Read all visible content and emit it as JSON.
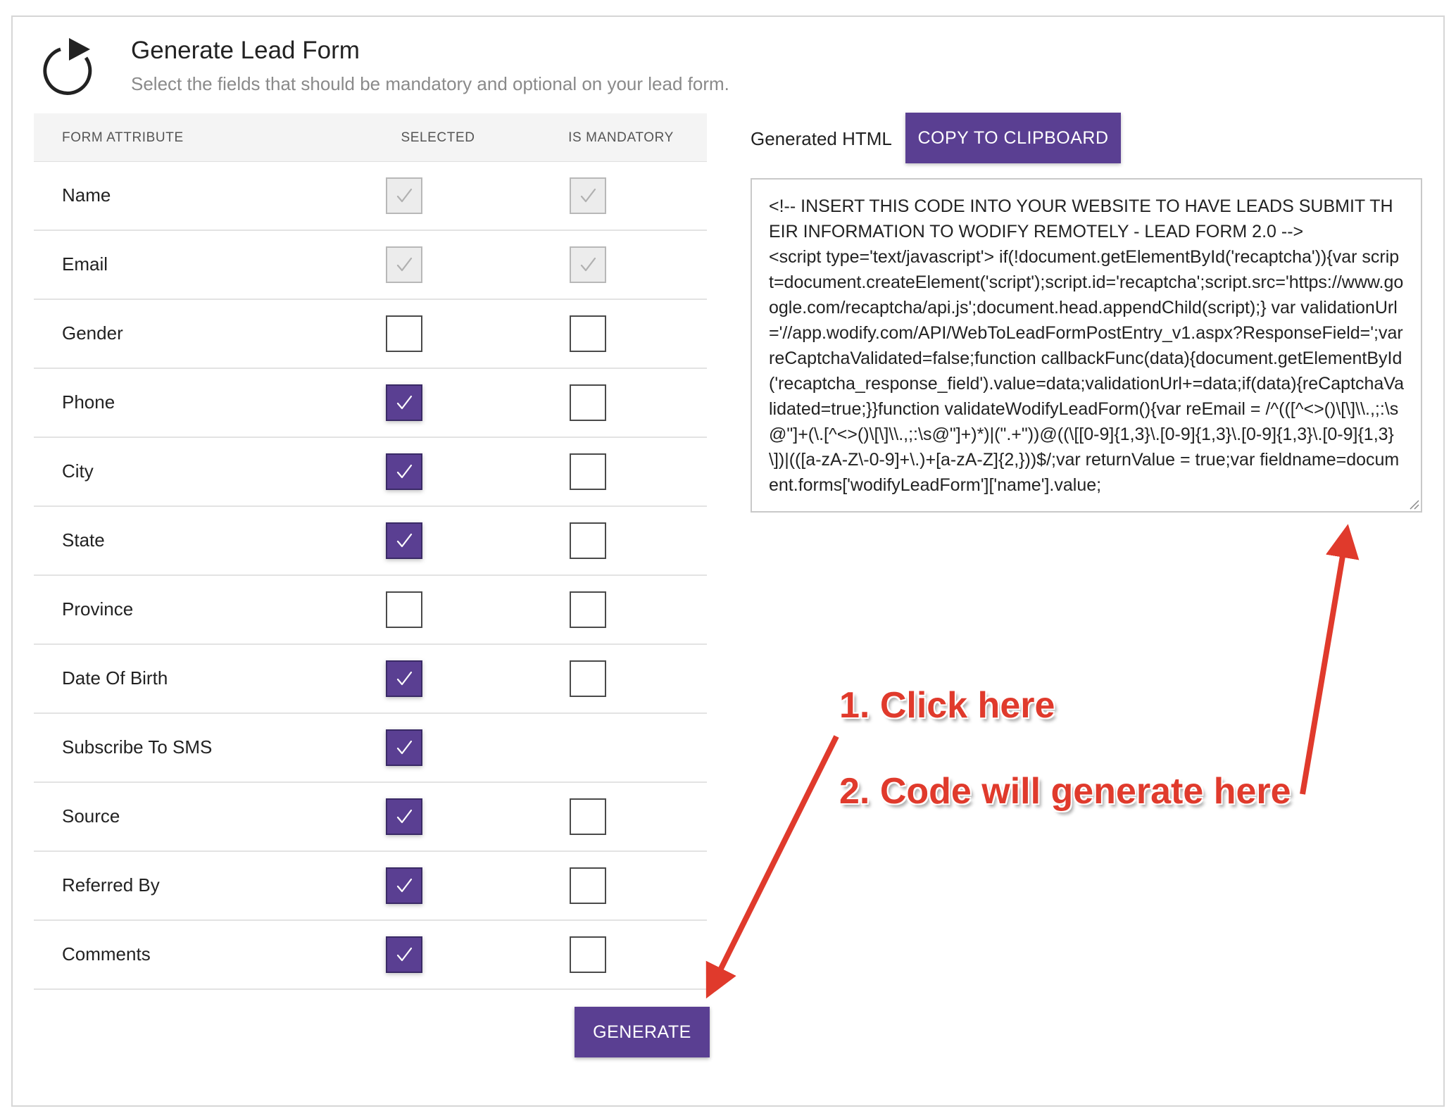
{
  "header": {
    "title": "Generate Lead Form",
    "subtitle": "Select the fields that should be mandatory and optional on your lead form."
  },
  "table": {
    "columns": [
      "FORM ATTRIBUTE",
      "SELECTED",
      "IS MANDATORY"
    ],
    "rows": [
      {
        "label": "Name",
        "selected": "checked-disabled",
        "mandatory": "checked-disabled"
      },
      {
        "label": "Email",
        "selected": "checked-disabled",
        "mandatory": "checked-disabled"
      },
      {
        "label": "Gender",
        "selected": "unchecked",
        "mandatory": "unchecked"
      },
      {
        "label": "Phone",
        "selected": "checked",
        "mandatory": "unchecked"
      },
      {
        "label": "City",
        "selected": "checked",
        "mandatory": "unchecked"
      },
      {
        "label": "State",
        "selected": "checked",
        "mandatory": "unchecked"
      },
      {
        "label": "Province",
        "selected": "unchecked",
        "mandatory": "unchecked"
      },
      {
        "label": "Date Of Birth",
        "selected": "checked",
        "mandatory": "unchecked"
      },
      {
        "label": "Subscribe To SMS",
        "selected": "checked",
        "mandatory": "none"
      },
      {
        "label": "Source",
        "selected": "checked",
        "mandatory": "unchecked"
      },
      {
        "label": "Referred By",
        "selected": "checked",
        "mandatory": "unchecked"
      },
      {
        "label": "Comments",
        "selected": "checked",
        "mandatory": "unchecked"
      }
    ]
  },
  "buttons": {
    "generate": "GENERATE",
    "copy": "COPY TO CLIPBOARD"
  },
  "output": {
    "label": "Generated HTML",
    "code": "<!-- INSERT THIS CODE INTO YOUR WEBSITE TO HAVE LEADS SUBMIT THEIR INFORMATION TO WODIFY REMOTELY - LEAD FORM 2.0 -->\n<script type='text/javascript'> if(!document.getElementById('recaptcha')){var script=document.createElement('script');script.id='recaptcha';script.src='https://www.google.com/recaptcha/api.js';document.head.appendChild(script);} var validationUrl='//app.wodify.com/API/WebToLeadFormPostEntry_v1.aspx?ResponseField=';var reCaptchaValidated=false;function callbackFunc(data){document.getElementById('recaptcha_response_field').value=data;validationUrl+=data;if(data){reCaptchaValidated=true;}}function validateWodifyLeadForm(){var reEmail = /^(([^<>()\\[\\]\\\\.,;:\\s@\"]+(\\.[^<>()\\[\\]\\\\.,;:\\s@\"]+)*)|(\".+\"))@((\\[[0-9]{1,3}\\.[0-9]{1,3}\\.[0-9]{1,3}\\.[0-9]{1,3}\\])|(([a-zA-Z\\-0-9]+\\.)+[a-zA-Z]{2,}))$/;var returnValue = true;var fieldname=document.forms['wodifyLeadForm']['name'].value;"
  },
  "annotations": {
    "step1": "1. Click here",
    "step2": "2. Code will generate here"
  },
  "colors": {
    "accent": "#5a3f92",
    "annotation": "#e03a2c"
  },
  "icons": {
    "header": "refresh-icon",
    "checkbox": "checkmark-icon"
  }
}
